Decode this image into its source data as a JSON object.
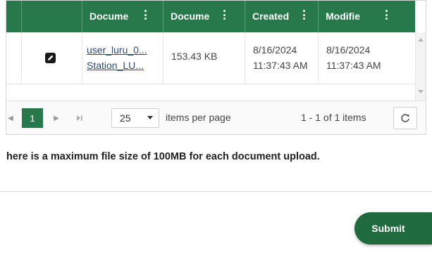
{
  "grid": {
    "columns": [
      {
        "label": ""
      },
      {
        "label": ""
      },
      {
        "label": "Docume"
      },
      {
        "label": "Docume"
      },
      {
        "label": "Created"
      },
      {
        "label": "Modifie"
      }
    ],
    "rows": [
      {
        "edit_icon": "pencil-icon",
        "name_line1": "user_luru_0...",
        "name_line2": "Station_LU...",
        "size": "153.43 KB",
        "created_date": "8/16/2024",
        "created_time": "11:37:43 AM",
        "modified_date": "8/16/2024",
        "modified_time": "11:37:43 AM"
      }
    ]
  },
  "pager": {
    "current_page": "1",
    "page_size": "25",
    "items_per_page_label": "items per page",
    "info": "1 - 1 of 1 items"
  },
  "notice": "here is a maximum file size of 100MB for each document upload.",
  "submit_label": "Submit",
  "colors": {
    "header_green": "#27784a",
    "submit_green": "#1f6b3f"
  }
}
